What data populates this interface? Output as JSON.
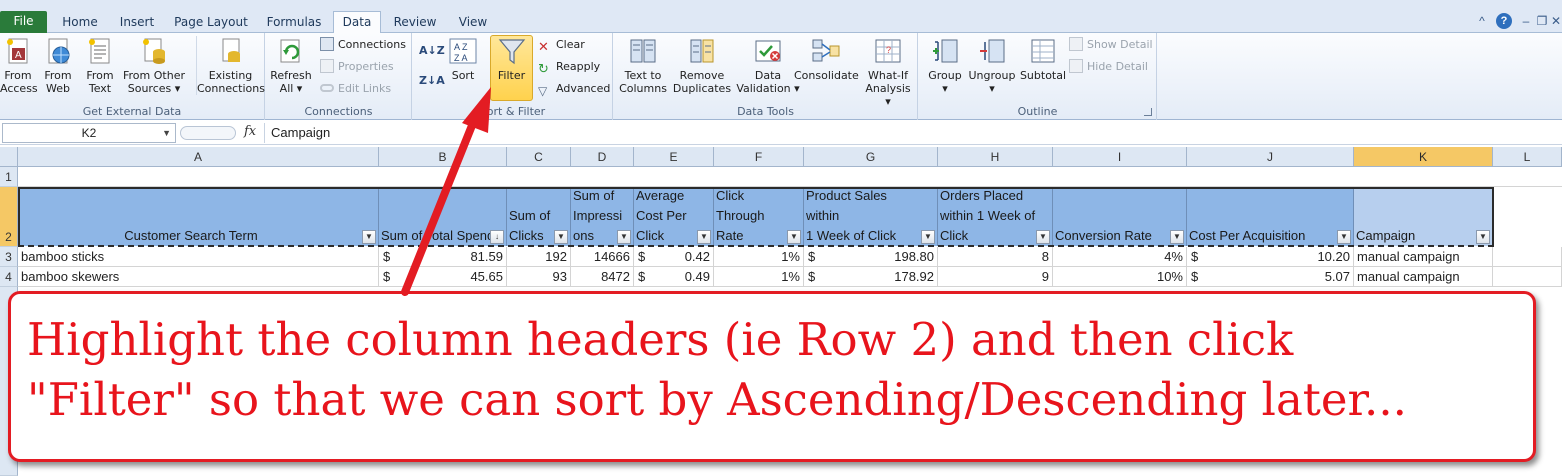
{
  "ribbon_tabs": [
    {
      "label": "File"
    },
    {
      "label": "Home"
    },
    {
      "label": "Insert"
    },
    {
      "label": "Page Layout"
    },
    {
      "label": "Formulas"
    },
    {
      "label": "Data"
    },
    {
      "label": "Review"
    },
    {
      "label": "View"
    }
  ],
  "active_tab": "Data",
  "window_controls": {
    "minimize_ribbon": "^",
    "help": "?",
    "minimize": "–",
    "restore": "❐",
    "close": "✕"
  },
  "groups": {
    "external": {
      "label": "Get External Data",
      "buttons": [
        {
          "line1": "From",
          "line2": "Access",
          "icon": "access-icon"
        },
        {
          "line1": "From",
          "line2": "Web",
          "icon": "globe-icon"
        },
        {
          "line1": "From",
          "line2": "Text",
          "icon": "text-file-icon"
        },
        {
          "line1": "From Other",
          "line2": "Sources ▾",
          "icon": "database-icon"
        }
      ],
      "existing": {
        "line1": "Existing",
        "line2": "Connections"
      }
    },
    "connections": {
      "label": "Connections",
      "refresh": {
        "line1": "Refresh",
        "line2": "All ▾"
      },
      "items": [
        {
          "label": "Connections",
          "enabled": true
        },
        {
          "label": "Properties",
          "enabled": false
        },
        {
          "label": "Edit Links",
          "enabled": false
        }
      ]
    },
    "sortfilter": {
      "label": "Sort & Filter",
      "sort": "Sort",
      "filter": "Filter",
      "items": [
        {
          "label": "Clear"
        },
        {
          "label": "Reapply"
        },
        {
          "label": "Advanced"
        }
      ]
    },
    "datatools": {
      "label": "Data Tools",
      "buttons": [
        {
          "line1": "Text to",
          "line2": "Columns"
        },
        {
          "line1": "Remove",
          "line2": "Duplicates"
        },
        {
          "line1": "Data",
          "line2": "Validation ▾"
        },
        {
          "line1": "Consolidate",
          "line2": ""
        },
        {
          "line1": "What-If",
          "line2": "Analysis ▾"
        }
      ]
    },
    "outline": {
      "label": "Outline",
      "buttons": [
        {
          "line1": "Group",
          "line2": "▾"
        },
        {
          "line1": "Ungroup",
          "line2": "▾"
        },
        {
          "line1": "Subtotal",
          "line2": ""
        }
      ],
      "items": [
        {
          "label": "Show Detail"
        },
        {
          "label": "Hide Detail"
        }
      ]
    }
  },
  "formula_bar": {
    "name_box": "K2",
    "fx": "fx",
    "value": "Campaign"
  },
  "columns": [
    "A",
    "B",
    "C",
    "D",
    "E",
    "F",
    "G",
    "H",
    "I",
    "J",
    "K",
    "L"
  ],
  "selected_column": "K",
  "row_numbers": [
    "1",
    "2",
    "3",
    "4"
  ],
  "header_row": [
    "Customer Search Term",
    "Sum of Total Spend",
    "Sum of Clicks",
    "Sum of Impressions",
    "Average Cost Per Click",
    "Click Through Rate",
    "Product Sales within 1 Week of Click",
    "Orders Placed within 1 Week of Click",
    "Conversion Rate",
    "Cost Per Acquisition",
    "Campaign"
  ],
  "header_row_wrapped": [
    [
      "Customer Search Term"
    ],
    [
      "Sum of Total Spend"
    ],
    [
      "Sum of",
      "Clicks"
    ],
    [
      "Sum of",
      "Impressi",
      "ons"
    ],
    [
      "Average",
      "Cost Per",
      "Click"
    ],
    [
      "Click Through",
      "Rate"
    ],
    [
      "Product Sales within",
      "1 Week of Click"
    ],
    [
      "Orders Placed",
      "within 1 Week of",
      "Click"
    ],
    [
      "Conversion Rate"
    ],
    [
      "Cost Per Acquisition"
    ],
    [
      "Campaign"
    ]
  ],
  "rows": [
    {
      "term": "bamboo sticks",
      "spend": "81.59",
      "clicks": "192",
      "impressions": "14666",
      "cpc": "0.42",
      "ctr": "1%",
      "sales": "198.80",
      "orders": "8",
      "conv": "4%",
      "cpa": "10.20",
      "campaign": "manual campaign"
    },
    {
      "term": "bamboo skewers",
      "spend": "45.65",
      "clicks": "93",
      "impressions": "8472",
      "cpc": "0.49",
      "ctr": "1%",
      "sales": "178.92",
      "orders": "9",
      "conv": "10%",
      "cpa": "5.07",
      "campaign": "manual campaign"
    }
  ],
  "currency_symbol": "$",
  "callout": {
    "line1": "Highlight the column headers (ie Row 2) and then click",
    "line2": "\"Filter\" so that we can sort by Ascending/Descending later..."
  },
  "colors": {
    "accent_red": "#e31c23",
    "header_fill": "#8eb6e6",
    "file_tab": "#2a7b3a",
    "selection": "#f5c865"
  }
}
